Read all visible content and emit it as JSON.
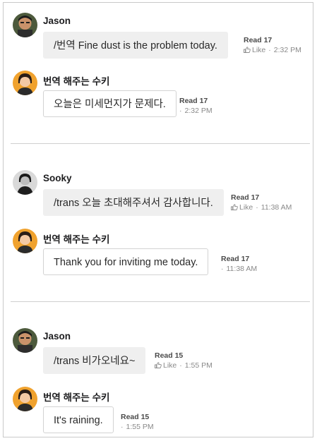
{
  "like_label": "Like",
  "dot": "·",
  "messages": [
    {
      "name": "Jason",
      "text": "/번역 Fine dust is the problem today.",
      "read": "Read 17",
      "time": "2:32 PM",
      "avatar": "jason"
    },
    {
      "name": "번역 해주는 수키",
      "text": "오늘은 미세먼지가 문제다.",
      "read": "Read 17",
      "time": "2:32 PM",
      "avatar": "suki"
    },
    {
      "name": "Sooky",
      "text": "/trans 오늘 초대해주셔서 감사합니다.",
      "read": "Read 17",
      "time": "11:38 AM",
      "avatar": "sooky"
    },
    {
      "name": "번역 해주는 수키",
      "text": "Thank you for inviting me today.",
      "read": "Read 17",
      "time": "11:38 AM",
      "avatar": "suki"
    },
    {
      "name": "Jason",
      "text": "/trans 비가오네요~",
      "read": "Read 15",
      "time": "1:55 PM",
      "avatar": "jason"
    },
    {
      "name": "번역 해주는 수키",
      "text": "It's raining.",
      "read": "Read 15",
      "time": "1:55 PM",
      "avatar": "suki"
    }
  ]
}
